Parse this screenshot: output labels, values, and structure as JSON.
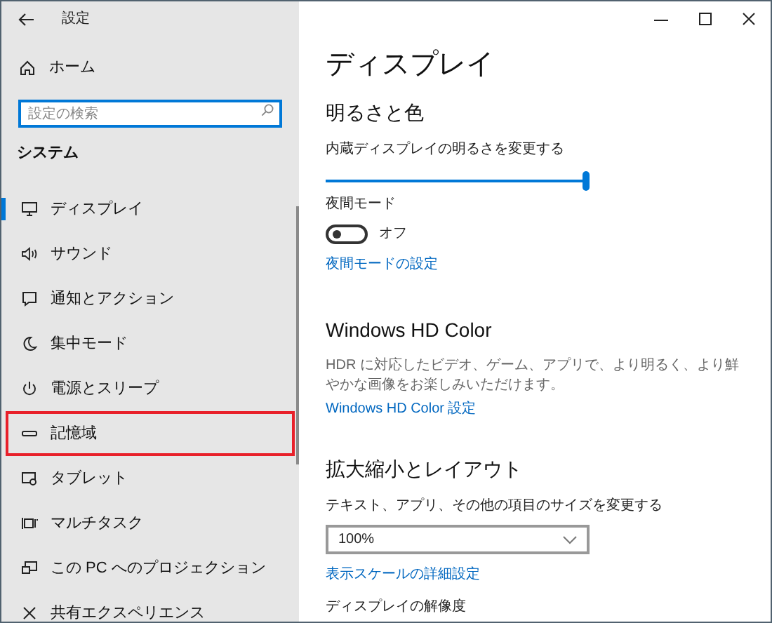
{
  "window": {
    "title": "設定"
  },
  "sidebar": {
    "home": "ホーム",
    "search": {
      "placeholder": "設定の検索"
    },
    "section": "システム",
    "items": [
      {
        "label": "ディスプレイ",
        "selected": true,
        "highlighted": false
      },
      {
        "label": "サウンド",
        "selected": false,
        "highlighted": false
      },
      {
        "label": "通知とアクション",
        "selected": false,
        "highlighted": false
      },
      {
        "label": "集中モード",
        "selected": false,
        "highlighted": false
      },
      {
        "label": "電源とスリープ",
        "selected": false,
        "highlighted": false
      },
      {
        "label": "記憶域",
        "selected": false,
        "highlighted": true
      },
      {
        "label": "タブレット",
        "selected": false,
        "highlighted": false
      },
      {
        "label": "マルチタスク",
        "selected": false,
        "highlighted": false
      },
      {
        "label": "この PC へのプロジェクション",
        "selected": false,
        "highlighted": false
      },
      {
        "label": "共有エクスペリエンス",
        "selected": false,
        "highlighted": false
      }
    ]
  },
  "content": {
    "title": "ディスプレイ",
    "brightness": {
      "heading": "明るさと色",
      "label": "内蔵ディスプレイの明るさを変更する",
      "level": 1.0
    },
    "night_light": {
      "label": "夜間モード",
      "on": false,
      "state_text": "オフ",
      "link": "夜間モードの設定"
    },
    "hd_color": {
      "heading": "Windows HD Color",
      "description": "HDR に対応したビデオ、ゲーム、アプリで、より明るく、より鮮やかな画像をお楽しみいただけます。",
      "link": "Windows HD Color 設定"
    },
    "scale": {
      "heading": "拡大縮小とレイアウト",
      "label": "テキスト、アプリ、その他の項目のサイズを変更する",
      "value": "100%",
      "link": "表示スケールの詳細設定"
    },
    "resolution": {
      "label": "ディスプレイの解像度"
    }
  }
}
